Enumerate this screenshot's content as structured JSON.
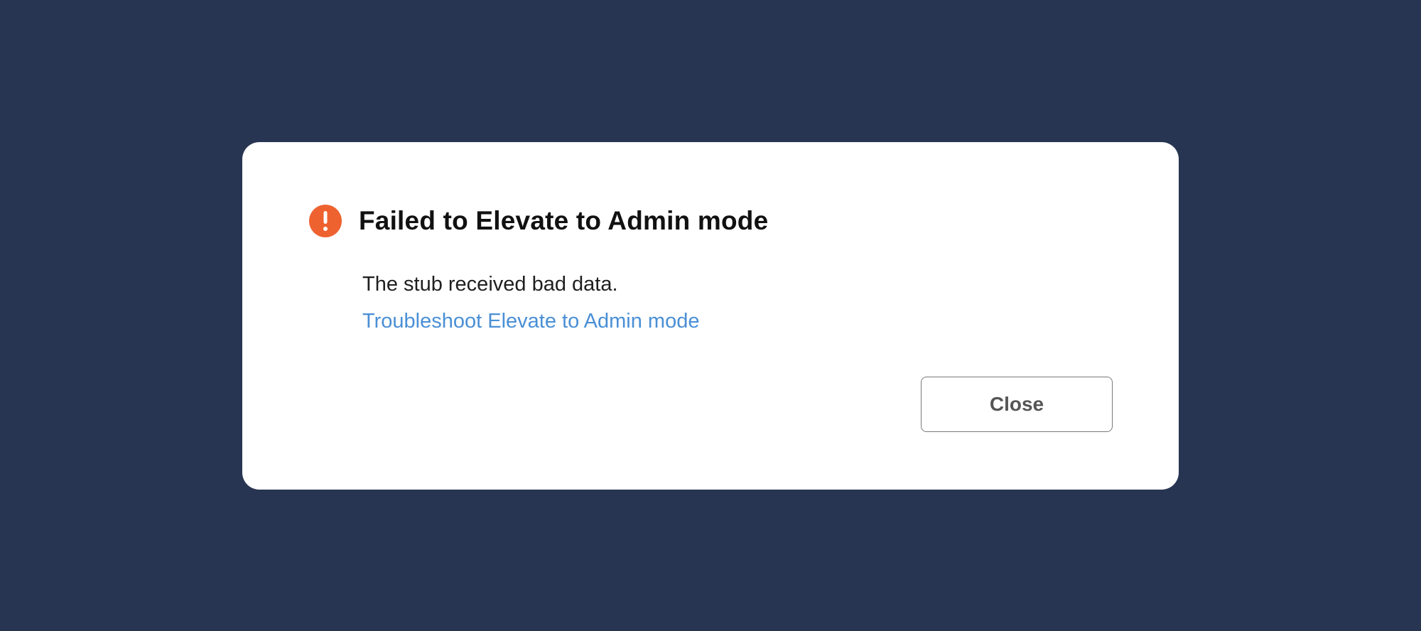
{
  "dialog": {
    "title": "Failed to Elevate to Admin mode",
    "message": "The stub received bad data.",
    "help_link": "Troubleshoot Elevate to Admin mode",
    "close_label": "Close",
    "icon": "exclamation-circle-icon"
  },
  "colors": {
    "background": "#283552",
    "dialog_background": "#ffffff",
    "alert_icon": "#ee6230",
    "link": "#4a8fd6",
    "title_text": "#111111",
    "button_border": "#7a7a7a",
    "button_text": "#555555"
  }
}
